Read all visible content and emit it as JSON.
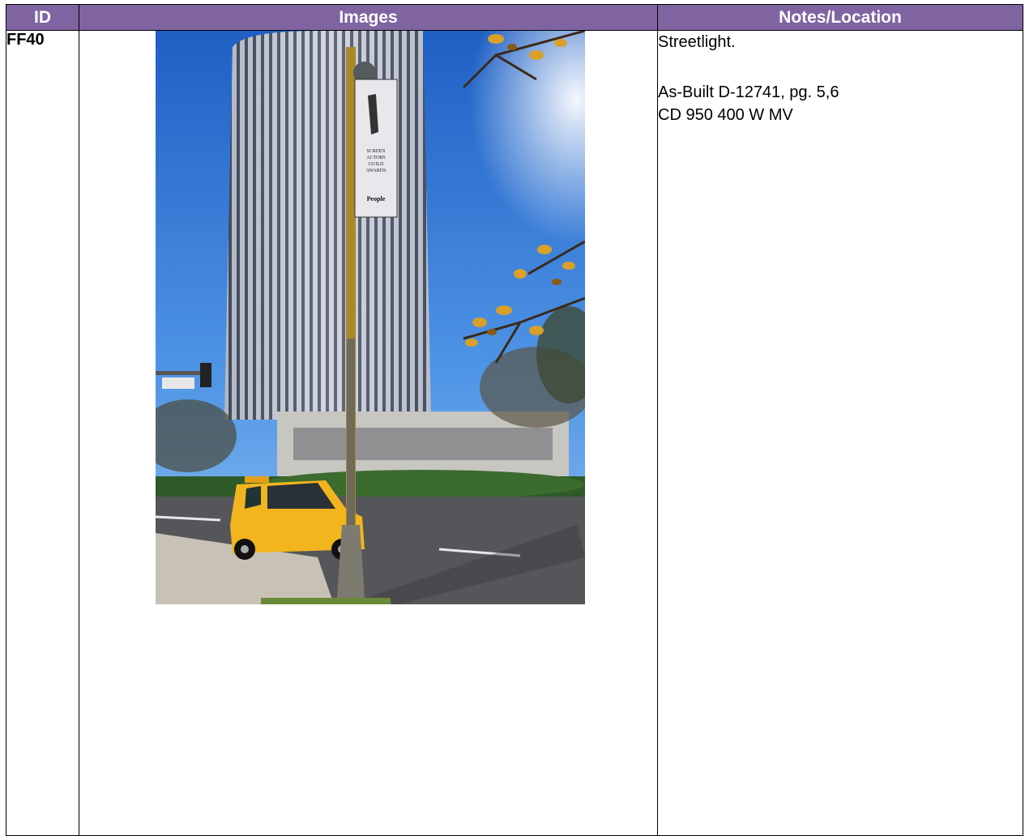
{
  "table": {
    "headers": {
      "id": "ID",
      "images": "Images",
      "notes": "Notes/Location"
    },
    "rows": [
      {
        "id": "FF40",
        "image": {
          "banner_lines": [
            "SCREEN",
            "ACTORS",
            "GUILD",
            "AWARDS"
          ],
          "banner_brand": "People"
        },
        "notes": {
          "line1": "Streetlight.",
          "line2": "As-Built D-12741, pg. 5,6",
          "line3": "CD 950 400 W MV"
        }
      }
    ]
  },
  "colors": {
    "header_bg": "#8064a2",
    "header_text": "#ffffff"
  }
}
